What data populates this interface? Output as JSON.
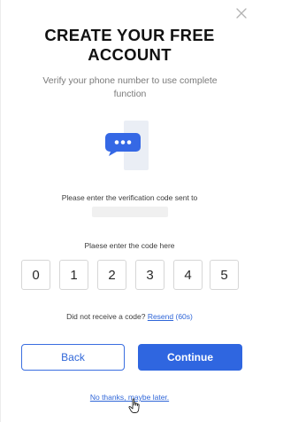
{
  "modal": {
    "title_line1": "CREATE YOUR FREE",
    "title_line2": "ACCOUNT",
    "subtitle": "Verify your phone number to use complete function"
  },
  "verification": {
    "instruction": "Please enter the verification code sent to",
    "code_label": "Plaese enter the code here",
    "digits": [
      "0",
      "1",
      "2",
      "3",
      "4",
      "5"
    ]
  },
  "resend": {
    "prompt": "Did not receive a code?",
    "link": "Resend",
    "timer": "(60s)"
  },
  "buttons": {
    "back": "Back",
    "continue": "Continue"
  },
  "footer": {
    "skip_link": "No thanks, maybe later."
  },
  "colors": {
    "accent": "#2f66e0",
    "bubble": "#3568e5",
    "muted_text": "#7a7a7a"
  },
  "icons": {
    "close": "close-icon",
    "chat": "chat-bubble-icon",
    "phone": "phone-illustration",
    "cursor": "hand-cursor-icon"
  }
}
